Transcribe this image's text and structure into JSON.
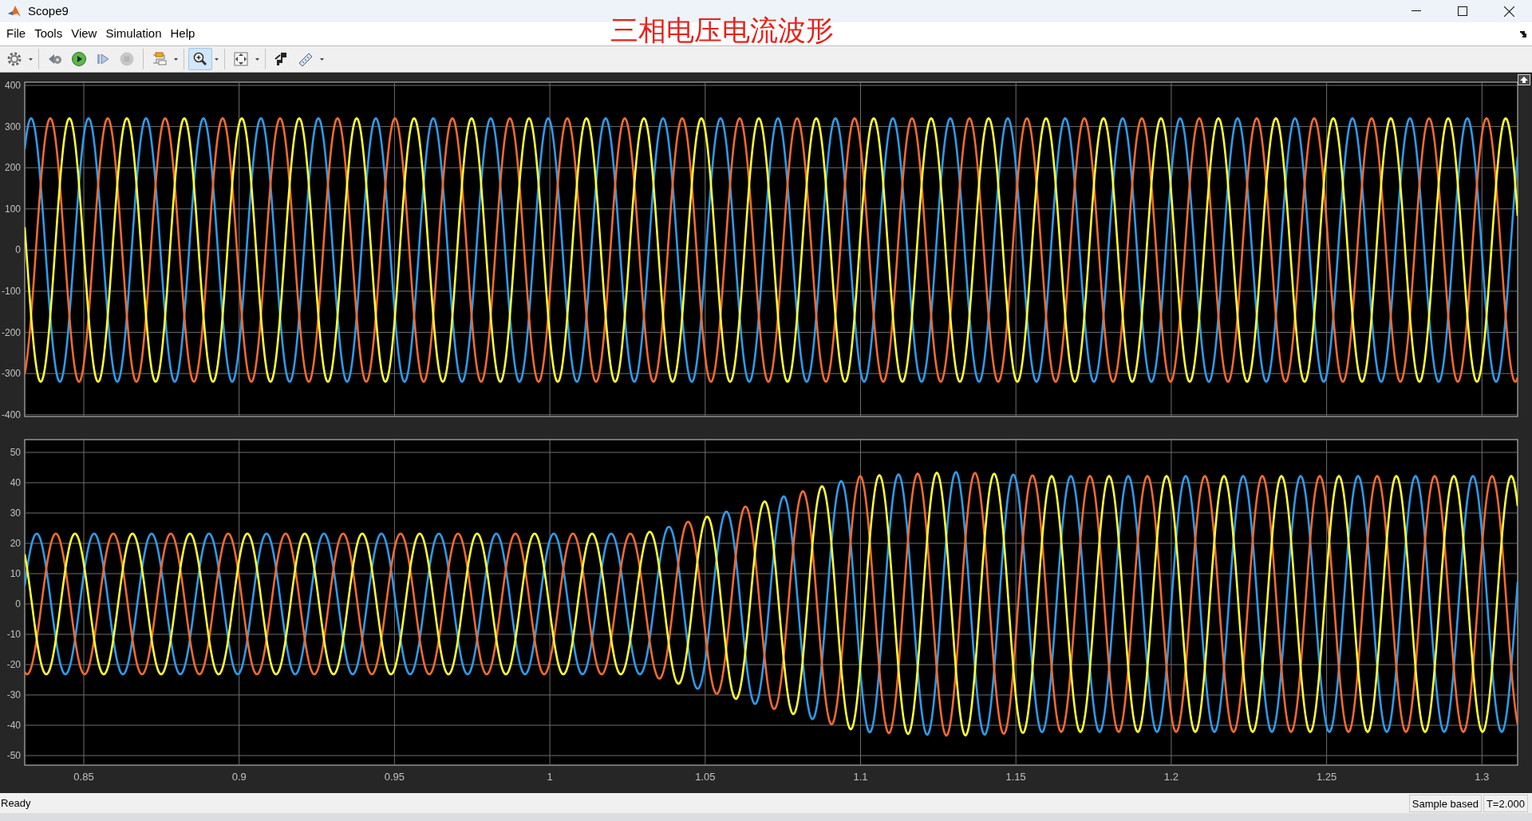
{
  "window": {
    "title": "Scope9"
  },
  "annotation": {
    "text": "三相电压电流波形"
  },
  "menu": [
    "File",
    "Tools",
    "View",
    "Simulation",
    "Help"
  ],
  "toolbar": [
    {
      "items": [
        {
          "kind": "settings",
          "selected": false,
          "disabled": false
        },
        {
          "kind": "dropdown"
        }
      ]
    },
    {
      "items": [
        {
          "kind": "step-back",
          "selected": false,
          "disabled": false
        },
        {
          "kind": "run",
          "selected": false,
          "disabled": false
        },
        {
          "kind": "step-forward",
          "selected": false,
          "disabled": false
        },
        {
          "kind": "stop",
          "selected": false,
          "disabled": true
        }
      ]
    },
    {
      "items": [
        {
          "kind": "signals",
          "selected": false,
          "disabled": false
        },
        {
          "kind": "dropdown"
        }
      ]
    },
    {
      "items": [
        {
          "kind": "zoom",
          "selected": true,
          "disabled": false
        },
        {
          "kind": "dropdown"
        }
      ]
    },
    {
      "items": [
        {
          "kind": "fit",
          "selected": false,
          "disabled": false
        },
        {
          "kind": "dropdown"
        }
      ]
    },
    {
      "items": [
        {
          "kind": "trigger",
          "selected": false,
          "disabled": false
        },
        {
          "kind": "measure",
          "selected": false,
          "disabled": false
        },
        {
          "kind": "dropdown"
        }
      ]
    }
  ],
  "plots": [
    {
      "yticks": [
        "400",
        "300",
        "200",
        "100",
        "0",
        "-100",
        "-200",
        "-300",
        "-400"
      ],
      "traces": [
        {
          "color": "#2e9bea"
        },
        {
          "color": "#f26b2d"
        },
        {
          "color": "#ffff33"
        }
      ]
    },
    {
      "yticks": [
        "50",
        "40",
        "30",
        "20",
        "10",
        "0",
        "-10",
        "-20",
        "-30",
        "-40",
        "-50"
      ],
      "traces": [
        {
          "color": "#2e9bea"
        },
        {
          "color": "#f26b2d"
        },
        {
          "color": "#ffff33"
        }
      ]
    }
  ],
  "xticks": [
    "0.85",
    "0.9",
    "0.95",
    "1",
    "1.05",
    "1.1",
    "1.15",
    "1.2",
    "1.25",
    "1.3"
  ],
  "status_bar": {
    "message": "Ready",
    "mode": "Sample based",
    "time": "T=2.000"
  }
}
